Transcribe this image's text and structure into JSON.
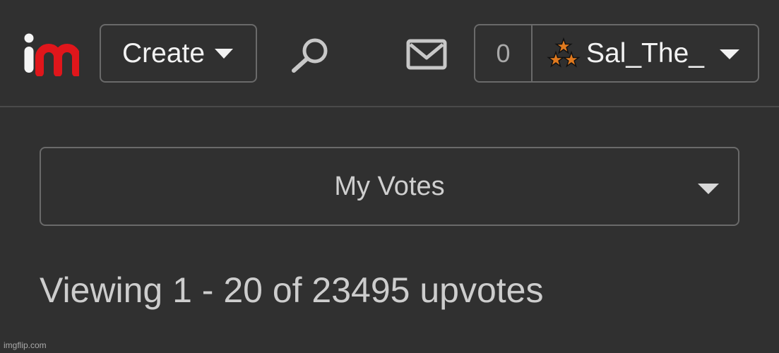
{
  "header": {
    "create_label": "Create",
    "notification_count": "0",
    "username": "Sal_The_"
  },
  "votes_filter": {
    "selected": "My Votes"
  },
  "summary": {
    "viewing_text": "Viewing 1 - 20 of 23495 upvotes"
  },
  "watermark": {
    "text": "imgflip.com"
  },
  "colors": {
    "background": "#303030",
    "logo_i": "#f5f5f5",
    "logo_m": "#e0161b",
    "border": "#6a6a6a",
    "avatar_star": "#e07a1f"
  },
  "icons": {
    "logo": "imgflip-logo",
    "search": "search-icon",
    "mail": "mail-icon",
    "avatar": "stars-avatar"
  }
}
